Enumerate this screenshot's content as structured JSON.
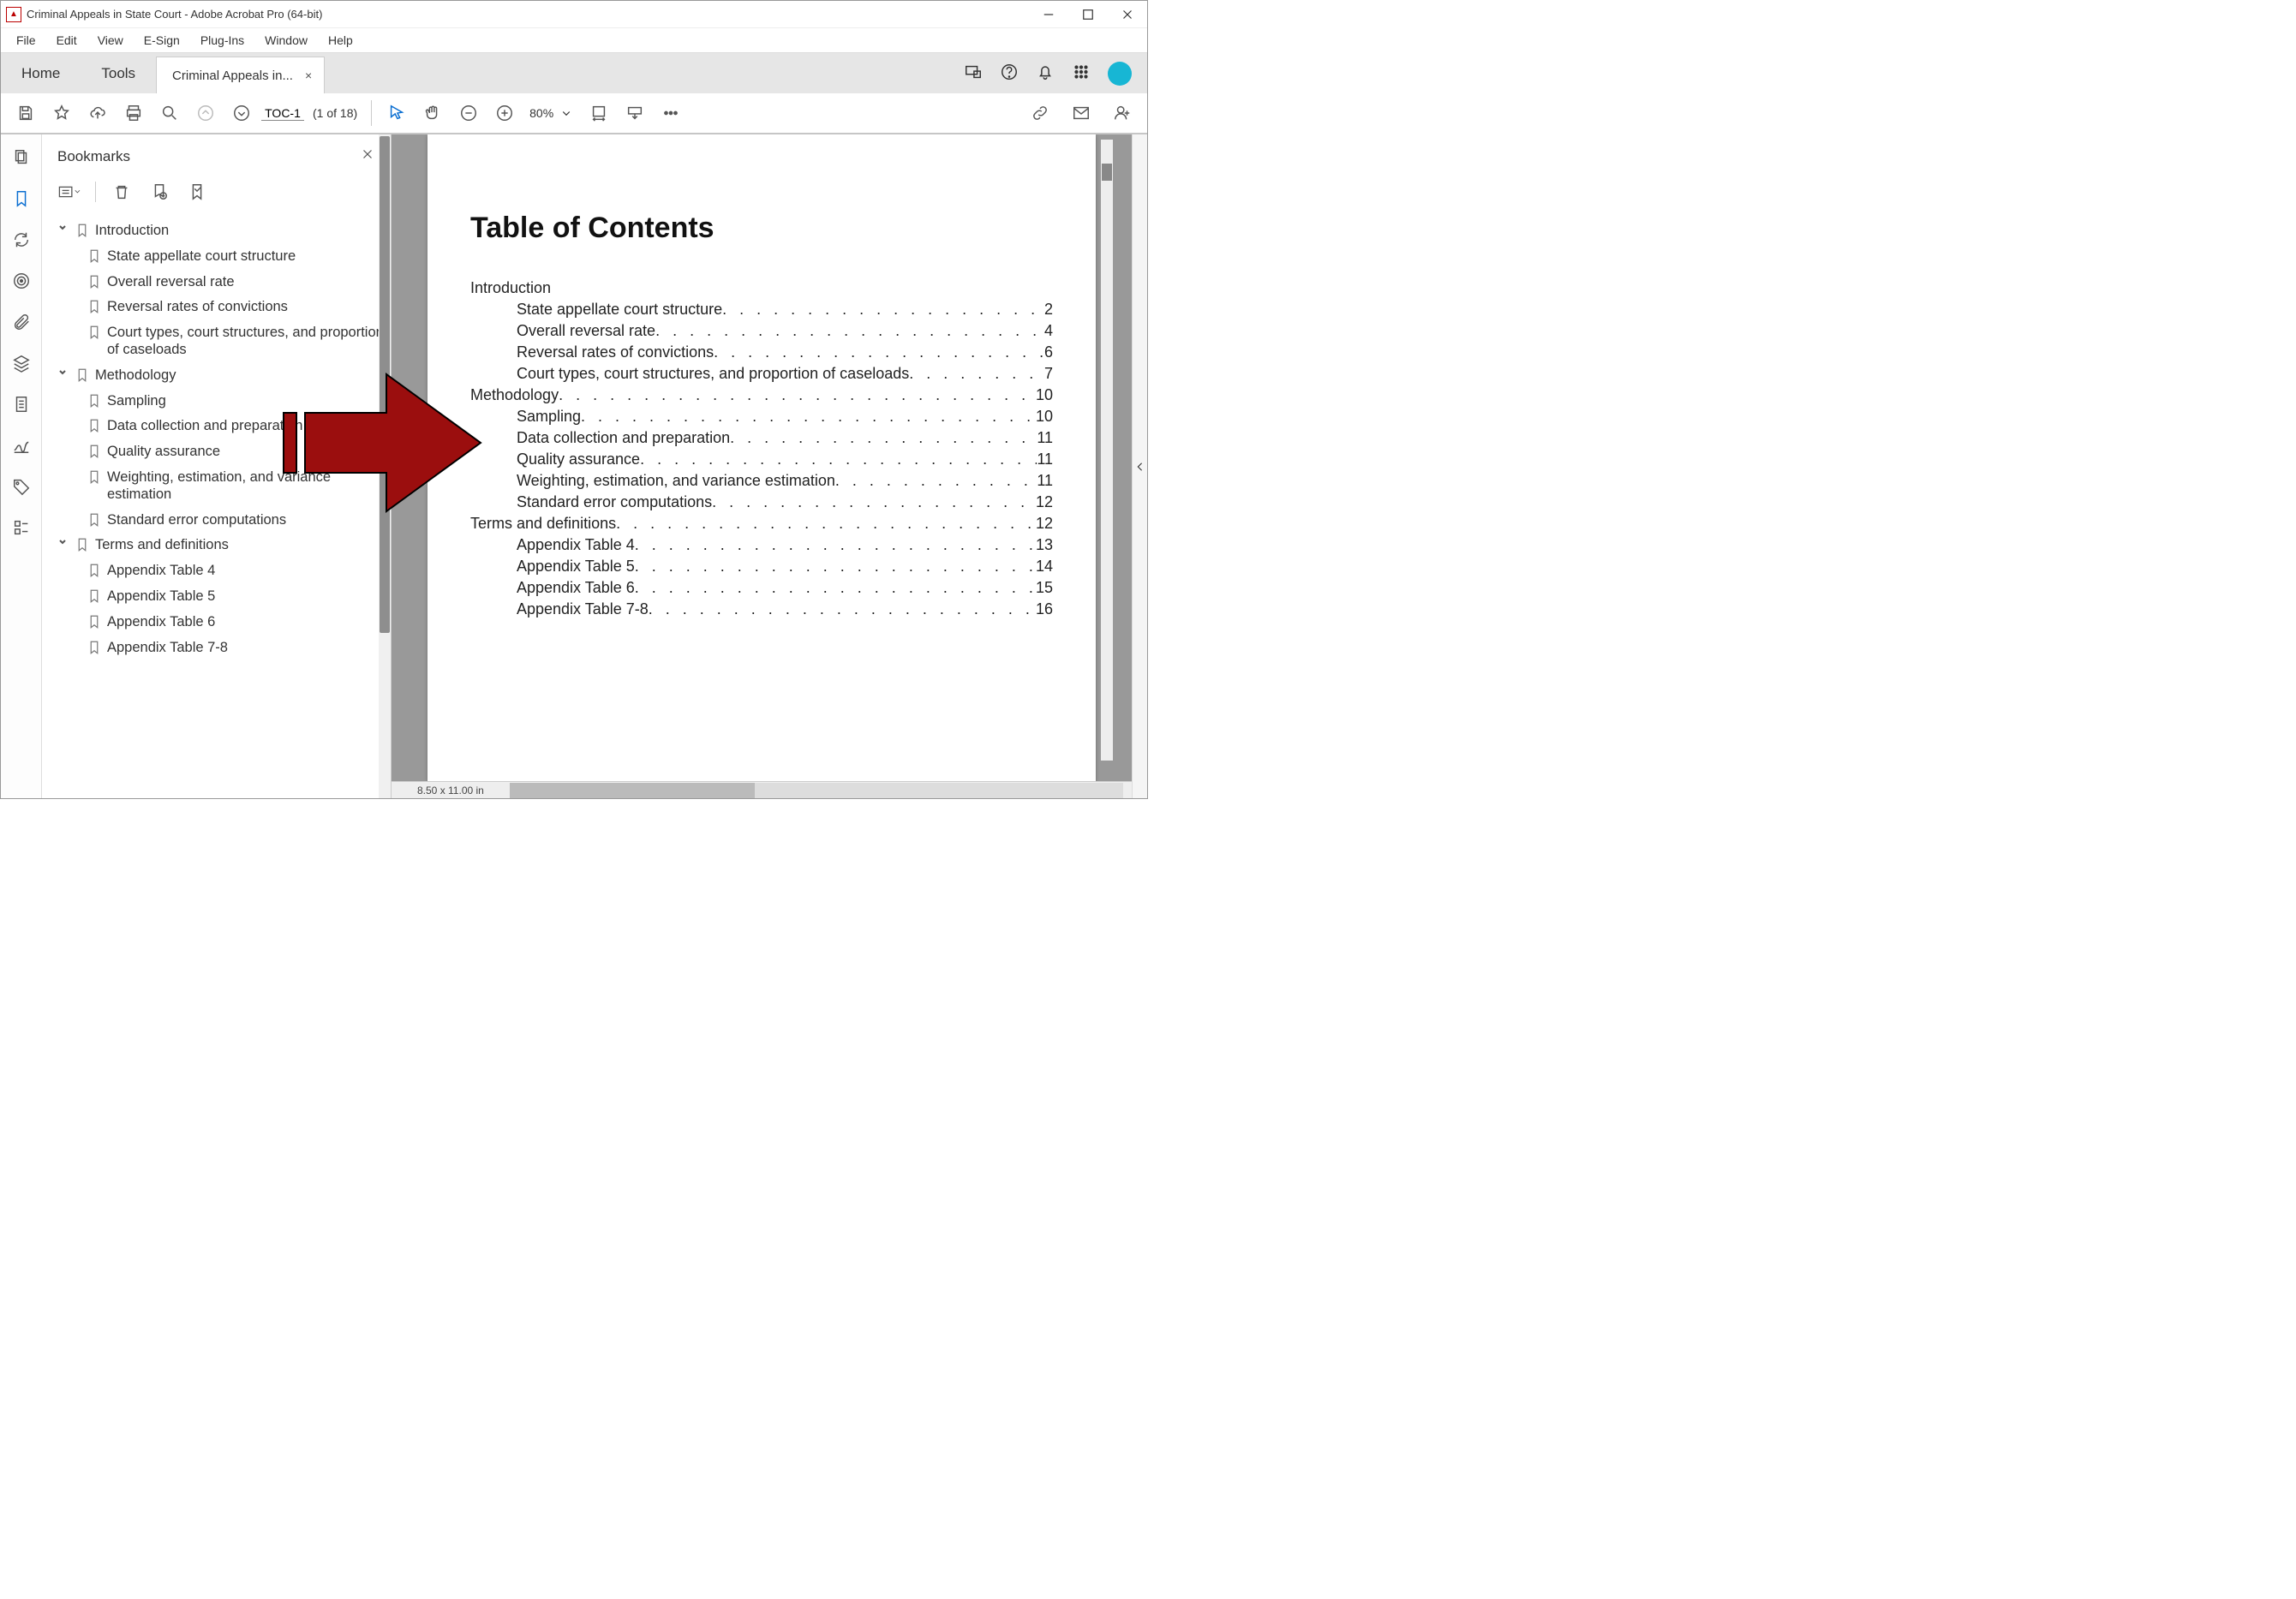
{
  "titlebar": {
    "title": "Criminal Appeals in State Court - Adobe Acrobat Pro (64-bit)"
  },
  "menubar": [
    "File",
    "Edit",
    "View",
    "E-Sign",
    "Plug-Ins",
    "Window",
    "Help"
  ],
  "tabstrip": {
    "home": "Home",
    "tools": "Tools",
    "doc_tab": "Criminal Appeals in...",
    "close_glyph": "×"
  },
  "toolbar": {
    "page_label": "TOC-1",
    "page_counter": "(1 of 18)",
    "zoom": "80%"
  },
  "bookmarks": {
    "heading": "Bookmarks",
    "tree": [
      {
        "label": "Introduction",
        "expanded": true,
        "children": [
          {
            "label": "State appellate court structure"
          },
          {
            "label": "Overall reversal rate"
          },
          {
            "label": "Reversal rates of convictions"
          },
          {
            "label": "Court types, court structures, and proportion of caseloads"
          }
        ]
      },
      {
        "label": "Methodology",
        "expanded": true,
        "children": [
          {
            "label": "Sampling"
          },
          {
            "label": "Data collection and preparation"
          },
          {
            "label": "Quality assurance"
          },
          {
            "label": "Weighting, estimation, and variance estimation"
          },
          {
            "label": "Standard error computations"
          }
        ]
      },
      {
        "label": "Terms and definitions",
        "expanded": true,
        "children": [
          {
            "label": "Appendix Table 4"
          },
          {
            "label": "Appendix Table 5"
          },
          {
            "label": "Appendix Table 6"
          },
          {
            "label": "Appendix Table 7-8"
          }
        ]
      }
    ]
  },
  "document": {
    "heading": "Table of Contents",
    "toc": [
      {
        "level": 1,
        "title": "Introduction",
        "page": ""
      },
      {
        "level": 2,
        "title": "State appellate court structure",
        "page": "2"
      },
      {
        "level": 2,
        "title": "Overall reversal rate",
        "page": "4"
      },
      {
        "level": 2,
        "title": "Reversal rates of convictions",
        "page": "6"
      },
      {
        "level": 2,
        "title": "Court types, court structures, and proportion of caseloads",
        "page": "7"
      },
      {
        "level": 1,
        "title": "Methodology",
        "page": "10"
      },
      {
        "level": 2,
        "title": "Sampling",
        "page": "10"
      },
      {
        "level": 2,
        "title": "Data collection and preparation",
        "page": "11"
      },
      {
        "level": 2,
        "title": "Quality assurance",
        "page": "11"
      },
      {
        "level": 2,
        "title": "Weighting, estimation, and variance estimation",
        "page": "11"
      },
      {
        "level": 2,
        "title": "Standard error computations",
        "page": "12"
      },
      {
        "level": 1,
        "title": "Terms and definitions",
        "page": "12"
      },
      {
        "level": 2,
        "title": "Appendix Table 4",
        "page": "13"
      },
      {
        "level": 2,
        "title": "Appendix Table 5",
        "page": "14"
      },
      {
        "level": 2,
        "title": "Appendix Table 6",
        "page": "15"
      },
      {
        "level": 2,
        "title": "Appendix Table 7-8",
        "page": "16"
      }
    ],
    "dimensions": "8.50 x 11.00 in"
  }
}
